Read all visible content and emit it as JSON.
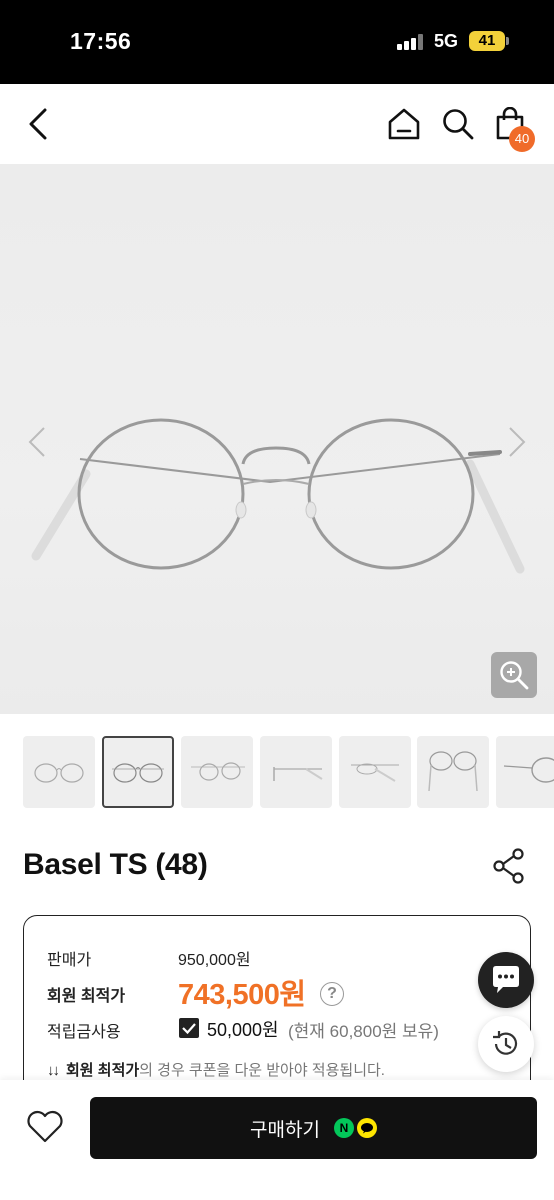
{
  "status_bar": {
    "time": "17:56",
    "network": "5G",
    "battery": "41"
  },
  "nav": {
    "icons": [
      "back-icon",
      "home-icon",
      "search-icon",
      "shopping-bag-icon"
    ],
    "cart_count": "40"
  },
  "gallery": {
    "thumbnail_count": 7,
    "selected_index": 1
  },
  "product": {
    "title": "Basel TS (48)"
  },
  "price": {
    "sale_label": "판매가",
    "sale_value": "950,000원",
    "member_label": "회원 최적가",
    "member_value": "743,500원",
    "help_symbol": "?",
    "points_label": "적립금사용",
    "points_value": "50,000원",
    "points_note": "(현재 60,800원 보유)",
    "notice_arrows": "↓↓",
    "notice_bold": "회원 최적가",
    "notice_rest": "의 경우 쿠폰을 다운 받아야 적용됩니다."
  },
  "bottom": {
    "buy_label": "구매하기",
    "npay_letter": "N"
  },
  "colors": {
    "accent_orange": "#f07126",
    "badge_orange": "#f06b2a",
    "naver_green": "#03c75a",
    "kakao_yellow": "#fee500"
  }
}
